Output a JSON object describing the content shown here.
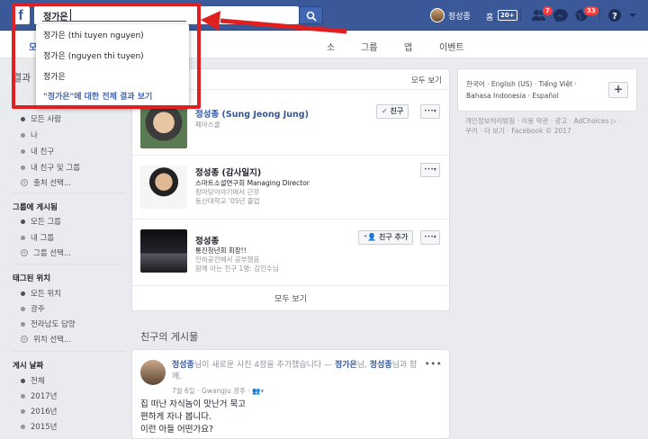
{
  "topbar": {
    "logo": "f",
    "search_value": "정가은",
    "profile_name": "정성종",
    "home_label": "홈",
    "home_badge": "20+",
    "friend_badge": "7",
    "notif_badge": "33"
  },
  "search_suggestions": {
    "items": [
      "정가은 (thi tuyen nguyen)",
      "정가은 (nguyen thi tuyen)",
      "정가은"
    ],
    "full_results": "\"정가은\"에 대한 전체 결과 보기"
  },
  "subnav": {
    "items": [
      "모",
      "소",
      "그룹",
      "앱",
      "이벤트"
    ]
  },
  "filters": {
    "results_title": "결과",
    "group1_title": "",
    "group1": [
      "모든 사람",
      "나",
      "내 친구",
      "내 친구 및 그룹"
    ],
    "group1_more": "출처 선택...",
    "group2_title": "그룹에 게시됨",
    "group2": [
      "모든 그룹",
      "내 그룹"
    ],
    "group2_more": "그룹 선택...",
    "group3_title": "태그된 위치",
    "group3": [
      "모든 위치",
      "광주",
      "전라남도 담양"
    ],
    "group3_more": "위치 선택...",
    "group4_title": "게시 날짜",
    "group4": [
      "전체",
      "2017년",
      "2016년",
      "2015년"
    ]
  },
  "people": {
    "see_all_top": "모두 보기",
    "list": [
      {
        "name": "정성종 (Sung Jeong Jung)",
        "lines": [
          "페마스쿨"
        ],
        "button": "✓ 친구"
      },
      {
        "name": "정성종 (감사일지)",
        "lines": [
          "스마트소셜연구회 Managing Director",
          "창마당이야기에서 근무",
          "동산대학교 '05년 졸업"
        ],
        "button": ""
      },
      {
        "name": "정성종",
        "lines": [
          "통진청년회 회장!!",
          "인하공전에서 공부했음",
          "함께 아는 친구 1명: 김인수님"
        ],
        "button": "친구 추가"
      }
    ],
    "see_all_bottom": "모두 보기"
  },
  "friends_posts_title": "친구의 게시물",
  "post": {
    "author": "정성종",
    "action": "님이 새로운 사진 4장을 추가했습니다 — ",
    "tagged": "정가은",
    "and": "님, ",
    "other": "정성종",
    "with": "님과 함께.",
    "meta": "7월 6일 · Gwangju 광주 · ",
    "body": [
      "집 떠난 자식놈이 맛난거 묵고",
      "편하게 자나 봅니다.",
      "이런 아들 어떤가요?"
    ]
  },
  "right": {
    "languages": "한국어 · English (US) · Tiếng Việt · Bahasa Indonesia · Español",
    "lang_plus": "+",
    "footer": "개인정보처리방침 · 이용 약관 · 광고 · AdChoices ▷ · 쿠키 · 더 보기 · Facebook © 2017"
  },
  "colors": {
    "brand": "#3b5998",
    "highlight": "#e02020"
  }
}
